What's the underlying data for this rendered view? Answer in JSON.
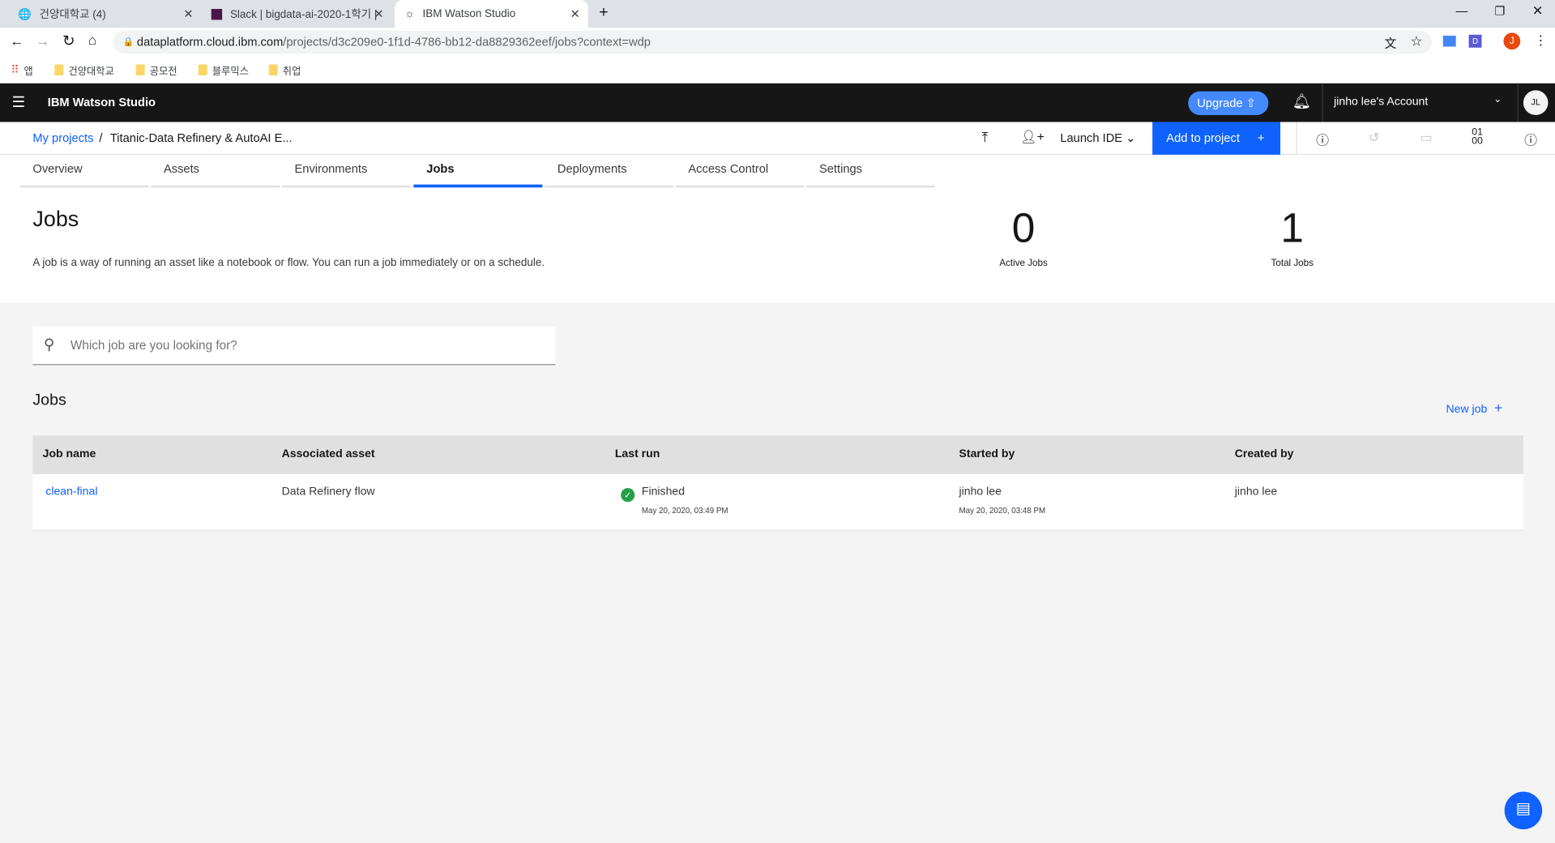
{
  "browser": {
    "tabs": [
      {
        "title": "건양대학교 (4)",
        "icon": "globe-icon"
      },
      {
        "title": "Slack | bigdata-ai-2020-1학기 |",
        "icon": "slack-icon"
      },
      {
        "title": "IBM Watson Studio",
        "icon": "watson-icon",
        "active": true
      }
    ],
    "url_host": "dataplatform.cloud.ibm.com",
    "url_path": "/projects/d3c209e0-1f1d-4786-bb12-da8829362eef/jobs?context=wdp",
    "bookmarks": [
      "앱",
      "건양대학교",
      "공모전",
      "블루믹스",
      "취업"
    ],
    "profile_initial": "J",
    "extension_label": "D"
  },
  "header": {
    "app_name": "IBM Watson Studio",
    "upgrade": "Upgrade",
    "account": "jinho lee's Account",
    "avatar": "JL"
  },
  "subnav": {
    "breadcrumb_root": "My projects",
    "breadcrumb_sep": "/",
    "project": "Titanic-Data Refinery & AutoAI E...",
    "launch_ide": "Launch IDE",
    "add_to_project": "Add to project"
  },
  "tabs": [
    "Overview",
    "Assets",
    "Environments",
    "Jobs",
    "Deployments",
    "Access Control",
    "Settings"
  ],
  "active_tab": "Jobs",
  "page": {
    "title": "Jobs",
    "description": "A job is a way of running an asset like a notebook or flow. You can run a job immediately or on a schedule.",
    "stats": [
      {
        "value": "0",
        "label": "Active Jobs"
      },
      {
        "value": "1",
        "label": "Total Jobs"
      }
    ]
  },
  "search": {
    "placeholder": "Which job are you looking for?"
  },
  "jobs_section": {
    "title": "Jobs",
    "new_job": "New job"
  },
  "table": {
    "columns": [
      "Job name",
      "Associated asset",
      "Last run",
      "Started by",
      "Created by"
    ],
    "rows": [
      {
        "name": "clean-final",
        "asset": "Data Refinery flow",
        "status": "Finished",
        "last_run": "May 20, 2020, 03:49 PM",
        "started_by": "jinho lee",
        "started_at": "May 20, 2020, 03:48 PM",
        "created_by": "jinho lee"
      }
    ]
  },
  "colors": {
    "primary": "#0f62fe",
    "link": "#0f62fe",
    "success": "#24a148",
    "header_bg": "#161616"
  }
}
